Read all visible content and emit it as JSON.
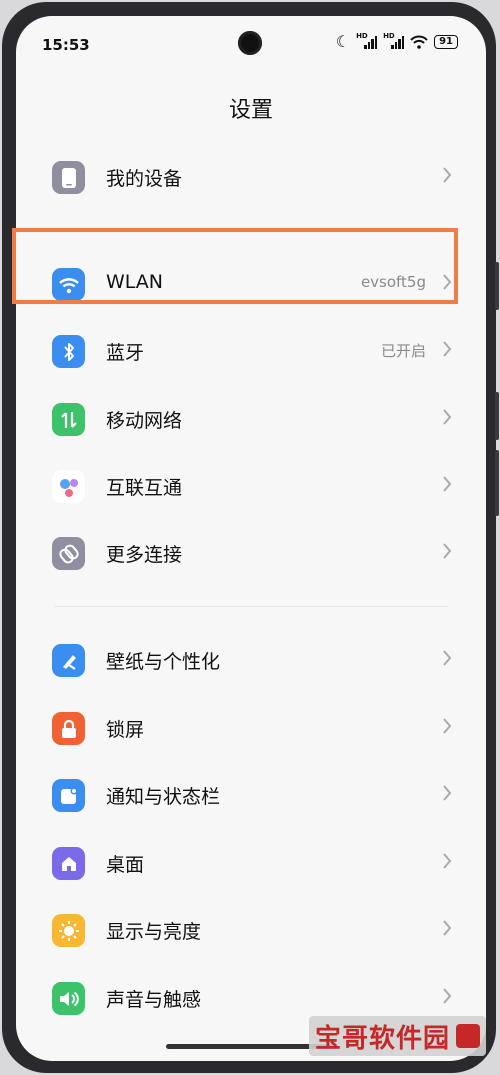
{
  "status_bar": {
    "time": "15:53",
    "hd1": "HD",
    "hd2": "HD",
    "battery": "91"
  },
  "header": {
    "title": "设置"
  },
  "sections": [
    {
      "items": [
        {
          "key": "my_device",
          "label": "我的设备",
          "value": "",
          "icon": "phone-icon",
          "color": "#8f8fa0"
        }
      ]
    },
    {
      "items": [
        {
          "key": "wlan",
          "label": "WLAN",
          "value": "evsoft5g",
          "icon": "wifi-icon",
          "color": "#3a8ef0"
        },
        {
          "key": "bluetooth",
          "label": "蓝牙",
          "value": "已开启",
          "icon": "bluetooth-icon",
          "color": "#3a8ef0"
        },
        {
          "key": "mobile_network",
          "label": "移动网络",
          "value": "",
          "icon": "mobile-network-icon",
          "color": "#3cc26a"
        },
        {
          "key": "interconnect",
          "label": "互联互通",
          "value": "",
          "icon": "interconnect-icon",
          "color": "#ffffff"
        },
        {
          "key": "more_connections",
          "label": "更多连接",
          "value": "",
          "icon": "link-icon",
          "color": "#8f8fa0"
        }
      ]
    },
    {
      "items": [
        {
          "key": "wallpaper",
          "label": "壁纸与个性化",
          "value": "",
          "icon": "wallpaper-icon",
          "color": "#3a8ef0"
        },
        {
          "key": "lockscreen",
          "label": "锁屏",
          "value": "",
          "icon": "lock-icon",
          "color": "#f06233"
        },
        {
          "key": "notifications",
          "label": "通知与状态栏",
          "value": "",
          "icon": "notification-icon",
          "color": "#3a8ef0"
        },
        {
          "key": "desktop",
          "label": "桌面",
          "value": "",
          "icon": "home-icon",
          "color": "#7a6ae8"
        },
        {
          "key": "display",
          "label": "显示与亮度",
          "value": "",
          "icon": "brightness-icon",
          "color": "#f7b731"
        },
        {
          "key": "sound",
          "label": "声音与触感",
          "value": "",
          "icon": "sound-icon",
          "color": "#3cc26a"
        }
      ]
    }
  ],
  "watermark": {
    "text": "宝哥软件园"
  }
}
